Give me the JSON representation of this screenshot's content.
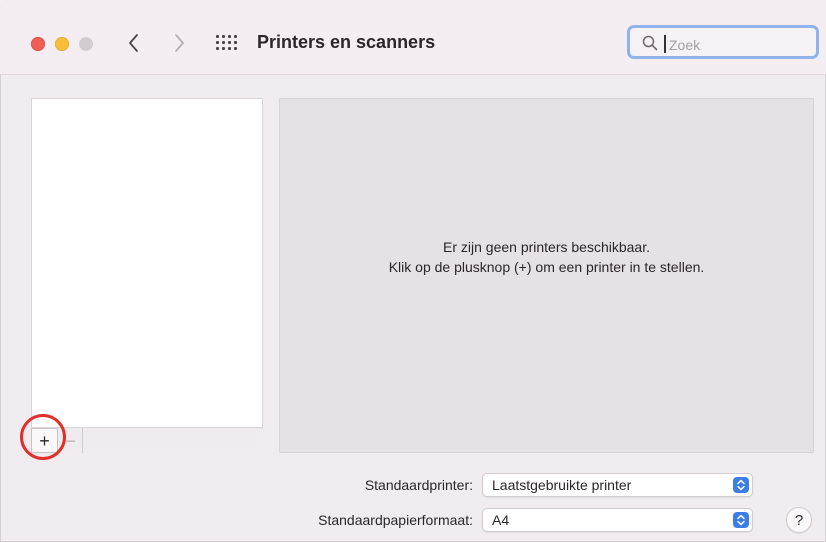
{
  "window": {
    "title": "Printers en scanners"
  },
  "search": {
    "placeholder": "Zoek",
    "value": ""
  },
  "list_toolbar": {
    "add_symbol": "+",
    "remove_symbol": "−"
  },
  "empty_state": {
    "line1": "Er zijn geen printers beschikbaar.",
    "line2": "Klik op de plusknop (+) om een printer in te stellen."
  },
  "settings": {
    "default_printer_label": "Standaardprinter:",
    "default_printer_value": "Laatstgebruikte printer",
    "default_paper_label": "Standaardpapierformaat:",
    "default_paper_value": "A4"
  },
  "help": {
    "symbol": "?"
  },
  "colors": {
    "accent": "#3c7ee6",
    "highlight": "#e0302a",
    "close": "#ee5e57",
    "minimize": "#f6bd3b"
  },
  "icons": [
    "chevron-left-icon",
    "chevron-right-icon",
    "grid-icon",
    "search-icon",
    "updown-chevron-icon"
  ]
}
